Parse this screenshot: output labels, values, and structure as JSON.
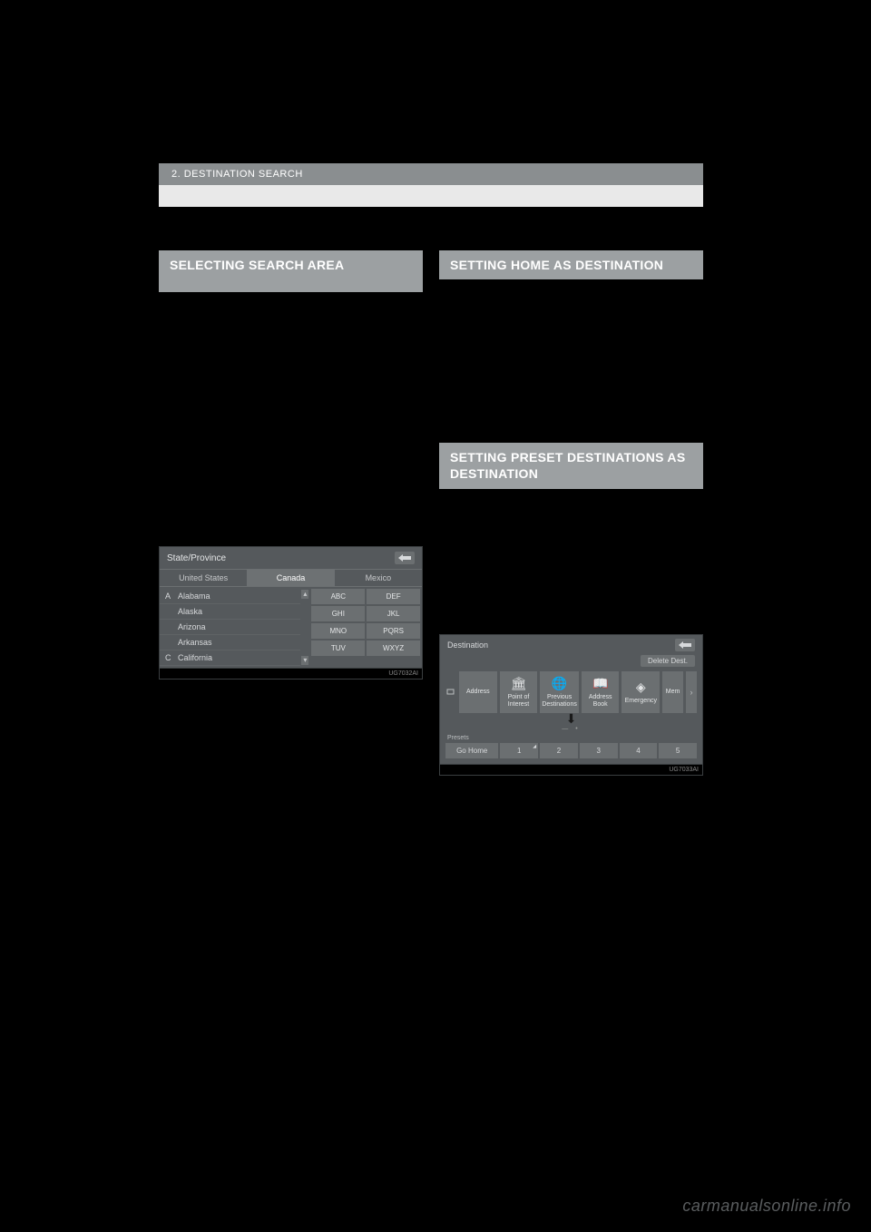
{
  "breadcrumb": "2. DESTINATION SEARCH",
  "left": {
    "heading": "SELECTING SEARCH AREA"
  },
  "right": {
    "heading1": "SETTING HOME AS DESTINATION",
    "heading2": "SETTING PRESET DESTINATIONS AS DESTINATION"
  },
  "sp": {
    "title": "State/Province",
    "tabs": [
      "United States",
      "Canada",
      "Mexico"
    ],
    "rows": [
      {
        "letter": "A",
        "name": "Alabama"
      },
      {
        "letter": "",
        "name": "Alaska"
      },
      {
        "letter": "",
        "name": "Arizona"
      },
      {
        "letter": "",
        "name": "Arkansas"
      },
      {
        "letter": "C",
        "name": "California"
      }
    ],
    "keys": [
      [
        "ABC",
        "DEF"
      ],
      [
        "GHI",
        "JKL"
      ],
      [
        "MNO",
        "PQRS"
      ],
      [
        "TUV",
        "WXYZ"
      ]
    ],
    "imgid": "UG7032AI"
  },
  "dest": {
    "title": "Destination",
    "delete": "Delete Dest.",
    "tiles": [
      {
        "icon": "card",
        "label": "Address"
      },
      {
        "icon": "bank",
        "label": "Point of Interest"
      },
      {
        "icon": "globe",
        "label": "Previous Destinations"
      },
      {
        "icon": "book",
        "label": "Address Book"
      },
      {
        "icon": "diamond",
        "label": "Emergency"
      },
      {
        "icon": "",
        "label": "Mem"
      }
    ],
    "presetsLabel": "Presets",
    "gohome": "Go Home",
    "presets": [
      "1",
      "2",
      "3",
      "4",
      "5"
    ],
    "imgid": "UG7033AI"
  },
  "watermark": "carmanualsonline.info"
}
